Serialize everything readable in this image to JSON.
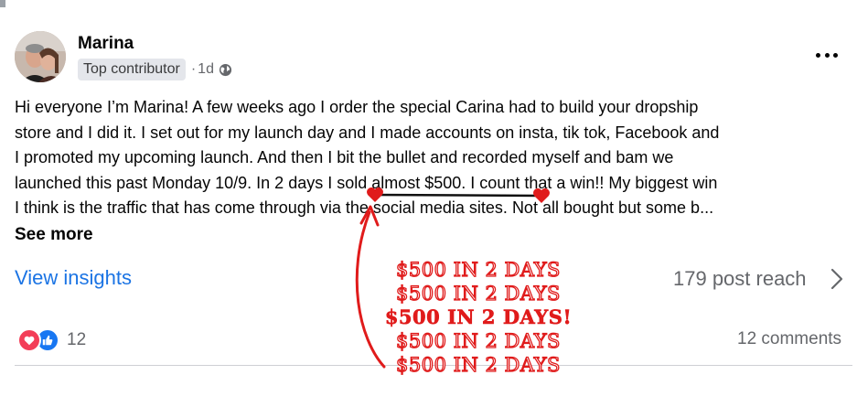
{
  "post": {
    "author": "Marina",
    "badge": "Top contributor",
    "separator": "·",
    "time": "1d",
    "more_icon": "more-horizontal-icon",
    "privacy_icon": "globe-icon",
    "text_lines": [
      "Hi everyone I’m Marina!  A few weeks ago I order the special Carina had to build your dropship",
      "store and I did it.  I set out for my launch day and I made accounts on insta, tik tok, Facebook and",
      "I promoted my upcoming launch. And then I bit the bullet and recorded myself and bam we",
      "launched this past Monday 10/9. In 2 days I sold almost $500. I count that a win!! My biggest win",
      "I think is the traffic that has come through via the social media sites. Not all bought but some b..."
    ],
    "see_more": "See more"
  },
  "insights": {
    "view_label": "View insights",
    "reach": "179 post reach"
  },
  "footer": {
    "reaction_icons": [
      "love-icon",
      "like-icon"
    ],
    "reaction_count": "12",
    "comments": "12 comments"
  },
  "annotation": {
    "color": "#e01b1b",
    "lines": [
      "$500 IN 2 DAYS",
      "$500 IN 2 DAYS",
      "$500 IN 2 DAYS!",
      "$500 IN 2 DAYS",
      "$500 IN 2 DAYS"
    ]
  }
}
